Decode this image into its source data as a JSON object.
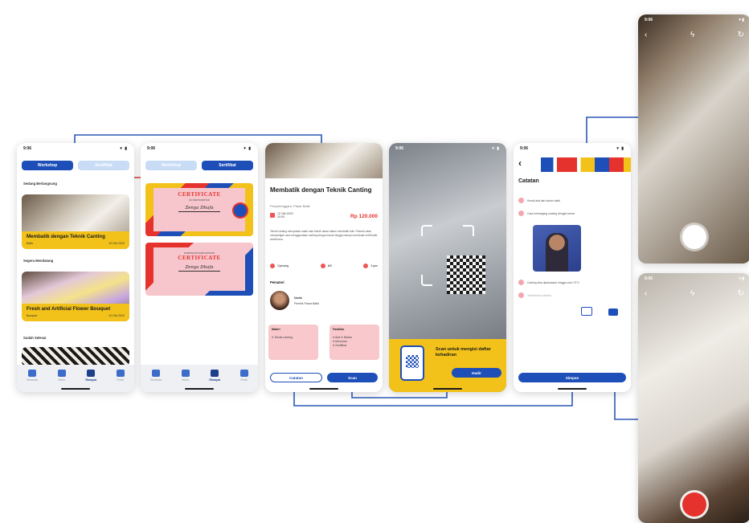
{
  "status_time": "9:06",
  "screen_workshop": {
    "tab_workshop": "Workshop",
    "tab_certificate": "Sertifikat",
    "section_ongoing": "Sedang Berlangsung",
    "card1_title": "Membatik dengan Teknik Canting",
    "card1_meta_left": "Batik",
    "card1_meta_right": "10 Okt 2023",
    "section_upcoming": "Segera Mendatang",
    "card2_title": "Fresh and Artificial Flower Bouquet",
    "card2_meta_left": "Bouquet",
    "card2_meta_right": "10 Okt 2023",
    "section_done": "Sudah Selesai"
  },
  "tabbar": [
    {
      "label": "Beranda"
    },
    {
      "label": "Video"
    },
    {
      "label": "Riwayat"
    },
    {
      "label": "Profil"
    }
  ],
  "screen_certificate": {
    "tab_workshop": "Workshop",
    "tab_certificate": "Sertifikat",
    "cert1_title": "CERTIFICATE",
    "cert1_sub": "OF PARTICIPATION",
    "cert1_name": "Zenya Dhafa",
    "cert2_top": "WORKSHOP PARTICIPATION",
    "cert2_title": "CERTIFICATE",
    "cert2_name": "Zenya Dhafa"
  },
  "screen_detail": {
    "title": "Membatik dengan Teknik Canting",
    "organizer": "Penyelenggara: Pasar Batik",
    "date": "12 Okt 2023",
    "time": "10:00",
    "price": "Rp 120.000",
    "desc": "Teknik canting merupakan salah satu teknik dasar dalam membatik tulis. Peserta akan mempelajari cara menggunakan canting dengan benar hingga mampu membuat motif batik sederhana.",
    "info_location": "Cipinang",
    "info_quota": "8/8",
    "info_duration": "3 jam",
    "mentor_heading": "Pemateri",
    "mentor_name": "Nadia",
    "mentor_role": "Pemilik Pasar Batik",
    "box_material_h": "Materi",
    "box_material_items": [
      "Teknik canting"
    ],
    "box_facility_h": "Fasilitas",
    "box_facility_items": [
      "Alat & Bahan",
      "Minuman",
      "Sertifikat"
    ],
    "btn_notes": "Catatan",
    "btn_scan": "Scan"
  },
  "screen_scan": {
    "prompt": "Scan untuk mengisi daftar kehadiran",
    "btn": "Hadir"
  },
  "screen_notes": {
    "heading": "Catatan",
    "notes": [
      "Kenali alat dan bahan batik",
      "Cara memegang canting dengan benar",
      "Canting bisa dipanaskan hingga suhu 70°C",
      "Tambahkan catatan..."
    ],
    "btn_save": "Simpan"
  },
  "camera_time": "9:06",
  "colors": {
    "primary": "#1e4fb8",
    "accent": "#f2c21a",
    "red": "#e5322d",
    "pink": "#f8c8cc",
    "connector": "#2c58b8",
    "connector_red": "#d8343a"
  }
}
